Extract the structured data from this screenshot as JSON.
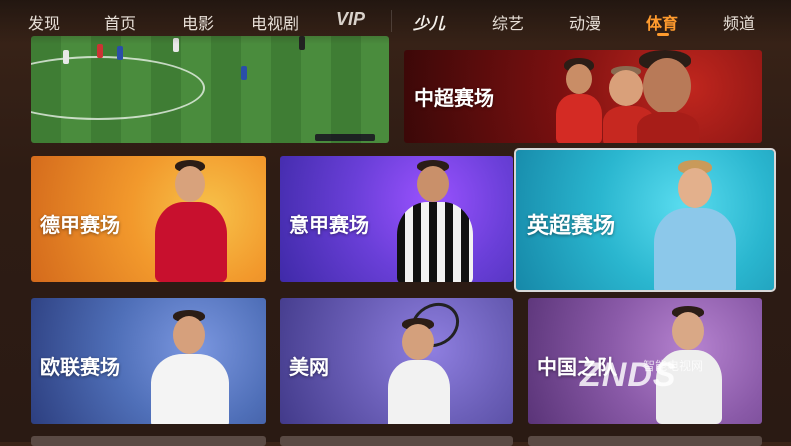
{
  "nav": {
    "items": [
      {
        "label": "发现"
      },
      {
        "label": "首页"
      },
      {
        "label": "电影"
      },
      {
        "label": "电视剧"
      },
      {
        "label": "VIP"
      },
      {
        "label": "少儿"
      },
      {
        "label": "综艺"
      },
      {
        "label": "动漫"
      },
      {
        "label": "体育"
      },
      {
        "label": "频道"
      }
    ],
    "active": "体育",
    "active_color": "#ff9b2e"
  },
  "tiles": {
    "video": {
      "label": ""
    },
    "csl": {
      "label": "中超赛场"
    },
    "bundesliga": {
      "label": "德甲赛场"
    },
    "serie_a": {
      "label": "意甲赛场"
    },
    "premier_league": {
      "label": "英超赛场"
    },
    "champions": {
      "label": "欧联赛场"
    },
    "us_open": {
      "label": "美网"
    },
    "china_team": {
      "label": "中国之队"
    }
  },
  "watermark": {
    "text": "ZNDS",
    "sub": "智能电视网"
  },
  "colors": {
    "bundesliga_bg": "#f0952c",
    "serie_a_bg": "#6a3fd8",
    "premier_bg": "#2ab6cf",
    "champions_bg": "#4f6fb8",
    "us_open_bg": "#6b5fb8",
    "china_bg": "#8a5aa8",
    "csl_bg": "#8a1414"
  }
}
